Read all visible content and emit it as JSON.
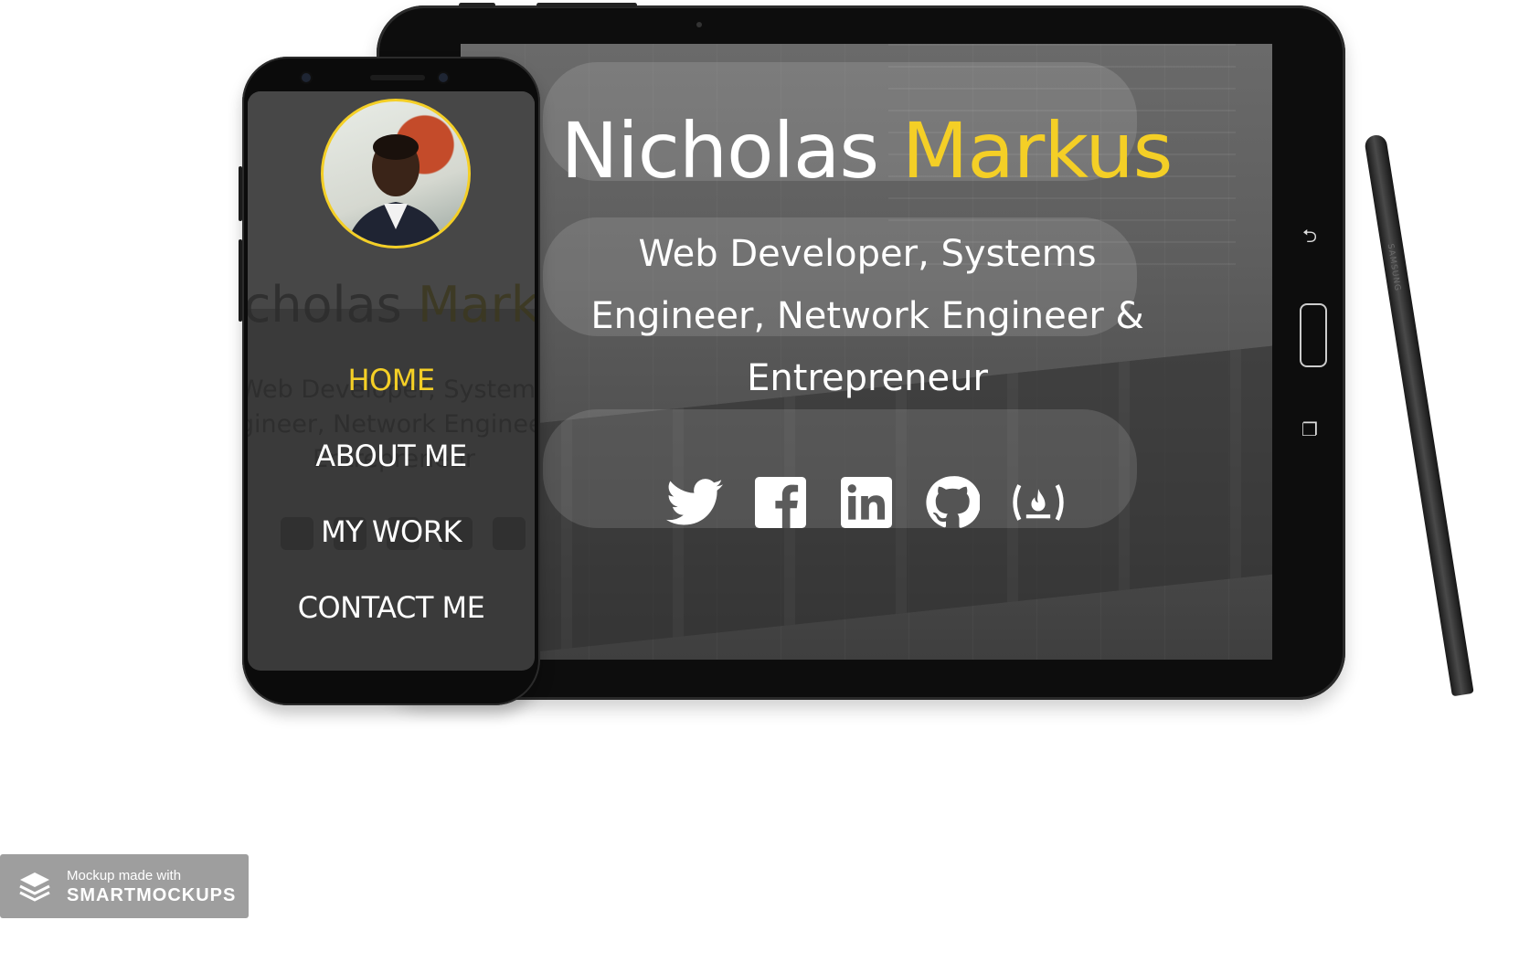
{
  "brand": {
    "first_name": "Nicholas",
    "last_name": "Markus",
    "accent_color": "#f4cf26",
    "tagline": "Web Developer, Systems Engineer, Network Engineer & Entrepreneur"
  },
  "social_icons": [
    "twitter-icon",
    "facebook-icon",
    "linkedin-icon",
    "github-icon",
    "freecodecamp-icon"
  ],
  "mobile_nav": {
    "items": [
      {
        "label": "HOME",
        "active": true
      },
      {
        "label": "ABOUT ME",
        "active": false
      },
      {
        "label": "MY WORK",
        "active": false
      },
      {
        "label": "CONTACT ME",
        "active": false
      }
    ]
  },
  "pen": {
    "brand": "SAMSUNG"
  },
  "watermark": {
    "line1": "Mockup made with",
    "line2": "SMARTMOCKUPS"
  }
}
